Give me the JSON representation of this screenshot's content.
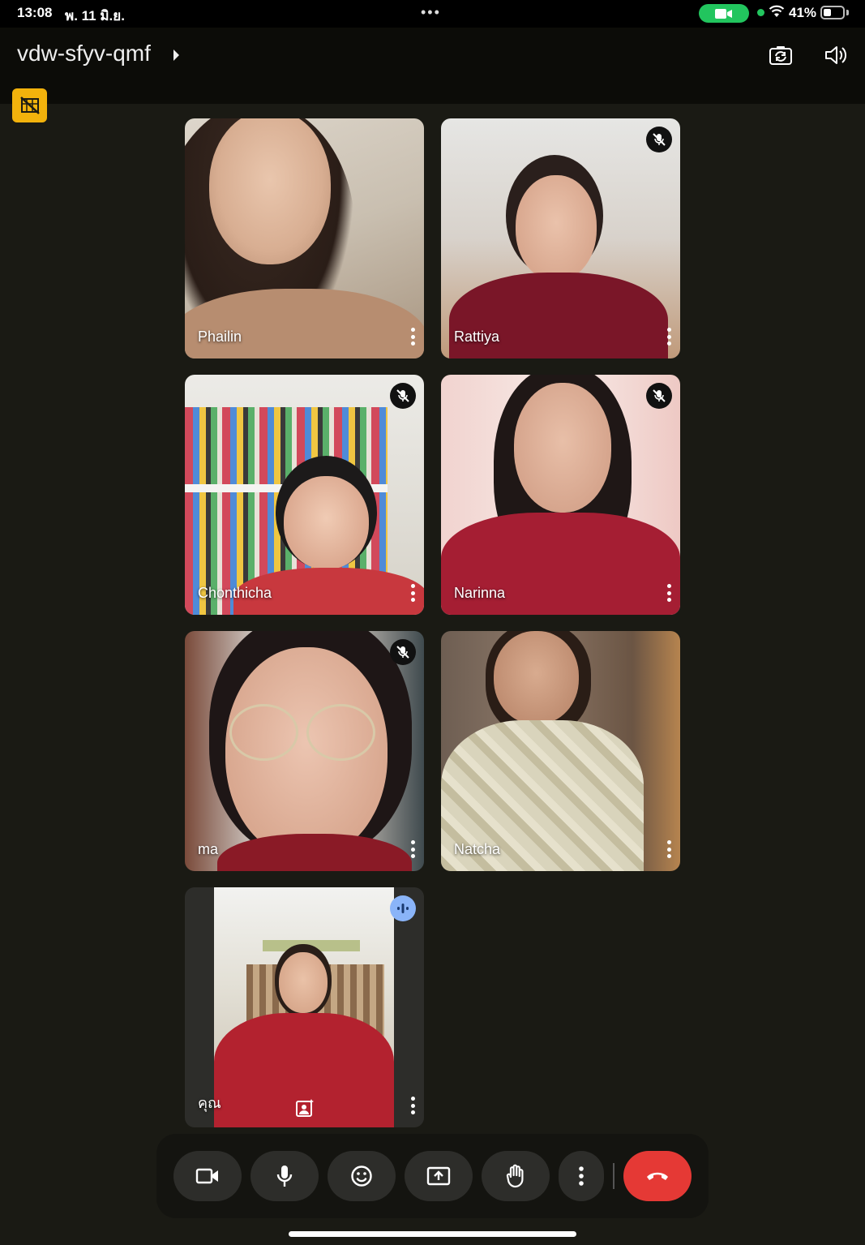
{
  "status_bar": {
    "time": "13:08",
    "date": "พ. 11 มิ.ย.",
    "battery_percent": "41%",
    "battery_level": 0.41
  },
  "header": {
    "meeting_code": "vdw-sfyv-qmf"
  },
  "participants": [
    {
      "name": "Phailin",
      "muted": false
    },
    {
      "name": "Rattiya",
      "muted": true
    },
    {
      "name": "Chonthicha",
      "muted": true
    },
    {
      "name": "Narinna",
      "muted": true
    },
    {
      "name": "ma",
      "muted": true
    },
    {
      "name": "Natcha",
      "muted": false
    },
    {
      "name": "คุณ",
      "muted": false,
      "speaking": true,
      "self": true
    }
  ],
  "toolbar": {
    "buttons": [
      "camera",
      "microphone",
      "reactions",
      "present",
      "raise-hand",
      "more-options",
      "end-call"
    ]
  },
  "colors": {
    "background": "#1a1a14",
    "end_call": "#e53935",
    "warning_badge": "#f2b20c",
    "speaking_badge": "#8ab4f8",
    "camera_pill": "#22c55e"
  }
}
